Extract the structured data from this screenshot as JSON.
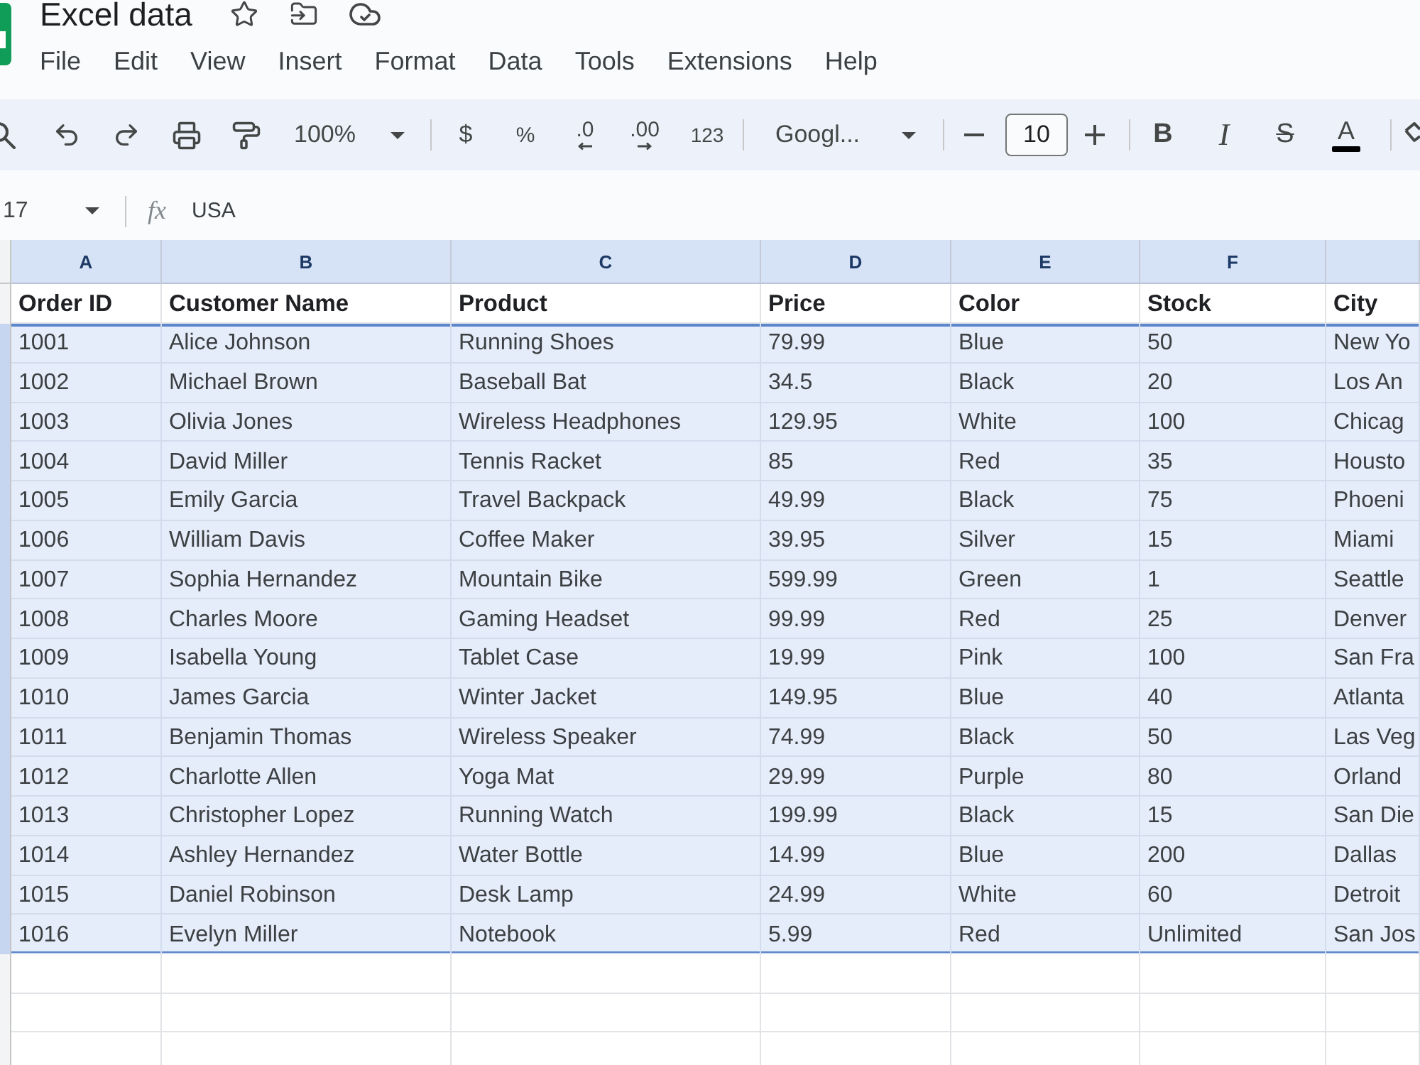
{
  "document": {
    "title": "Excel data"
  },
  "menu": [
    "File",
    "Edit",
    "View",
    "Insert",
    "Format",
    "Data",
    "Tools",
    "Extensions",
    "Help"
  ],
  "toolbar": {
    "zoom": "100%",
    "currency": "$",
    "percent": "%",
    "decrease_decimals": ".0",
    "increase_decimals": ".00",
    "number_formats": "123",
    "font": "Googl...",
    "font_size": "10",
    "text_styles": [
      {
        "kind": "bold",
        "label": "B"
      },
      {
        "kind": "italic",
        "label": "I"
      },
      {
        "kind": "strikethrough",
        "label": "S"
      },
      {
        "kind": "text_color",
        "label": "A"
      }
    ]
  },
  "formula_bar": {
    "cell_reference": "17",
    "function_label": "fx",
    "value": "USA"
  },
  "sheet": {
    "columns": [
      {
        "letter": "A",
        "selected": true
      },
      {
        "letter": "B",
        "selected": true
      },
      {
        "letter": "C",
        "selected": true
      },
      {
        "letter": "D",
        "selected": true
      },
      {
        "letter": "E",
        "selected": true
      },
      {
        "letter": "F",
        "selected": true
      },
      {
        "selected": true
      }
    ],
    "header_row": {
      "selected": false,
      "cells": [
        "Order ID",
        "Customer Name",
        "Product",
        "Price",
        "Color",
        "Stock",
        "City"
      ]
    },
    "rows": [
      {
        "selected": true,
        "cells": [
          "1001",
          "Alice Johnson",
          "Running Shoes",
          "79.99",
          "Blue",
          "50",
          "New Yo"
        ]
      },
      {
        "selected": true,
        "cells": [
          "1002",
          "Michael Brown",
          "Baseball Bat",
          "34.5",
          "Black",
          "20",
          "Los An"
        ]
      },
      {
        "selected": true,
        "cells": [
          "1003",
          "Olivia Jones",
          "Wireless Headphones",
          "129.95",
          "White",
          "100",
          "Chicag"
        ]
      },
      {
        "selected": true,
        "cells": [
          "1004",
          "David Miller",
          "Tennis Racket",
          "85",
          "Red",
          "35",
          "Housto"
        ]
      },
      {
        "selected": true,
        "cells": [
          "1005",
          "Emily Garcia",
          "Travel Backpack",
          "49.99",
          "Black",
          "75",
          "Phoeni"
        ]
      },
      {
        "selected": true,
        "cells": [
          "1006",
          "William Davis",
          "Coffee Maker",
          "39.95",
          "Silver",
          "15",
          "Miami"
        ]
      },
      {
        "selected": true,
        "cells": [
          "1007",
          "Sophia Hernandez",
          "Mountain Bike",
          "599.99",
          "Green",
          "1",
          "Seattle"
        ]
      },
      {
        "selected": true,
        "cells": [
          "1008",
          "Charles Moore",
          "Gaming Headset",
          "99.99",
          "Red",
          "25",
          "Denver"
        ]
      },
      {
        "selected": true,
        "cells": [
          "1009",
          "Isabella Young",
          "Tablet Case",
          "19.99",
          "Pink",
          "100",
          "San Fra"
        ]
      },
      {
        "selected": true,
        "cells": [
          "1010",
          "James Garcia",
          "Winter Jacket",
          "149.95",
          "Blue",
          "40",
          "Atlanta"
        ]
      },
      {
        "selected": true,
        "cells": [
          "1011",
          "Benjamin Thomas",
          "Wireless Speaker",
          "74.99",
          "Black",
          "50",
          "Las Veg"
        ]
      },
      {
        "selected": true,
        "cells": [
          "1012",
          "Charlotte Allen",
          "Yoga Mat",
          "29.99",
          "Purple",
          "80",
          "Orland"
        ]
      },
      {
        "selected": true,
        "cells": [
          "1013",
          "Christopher Lopez",
          "Running Watch",
          "199.99",
          "Black",
          "15",
          "San Die"
        ]
      },
      {
        "selected": true,
        "cells": [
          "1014",
          "Ashley Hernandez",
          "Water Bottle",
          "14.99",
          "Blue",
          "200",
          "Dallas"
        ]
      },
      {
        "selected": true,
        "cells": [
          "1015",
          "Daniel Robinson",
          "Desk Lamp",
          "24.99",
          "White",
          "60",
          "Detroit"
        ]
      },
      {
        "selected": true,
        "cells": [
          "1016",
          "Evelyn Miller",
          "Notebook",
          "5.99",
          "Red",
          "Unlimited",
          "San Jos"
        ]
      }
    ]
  }
}
